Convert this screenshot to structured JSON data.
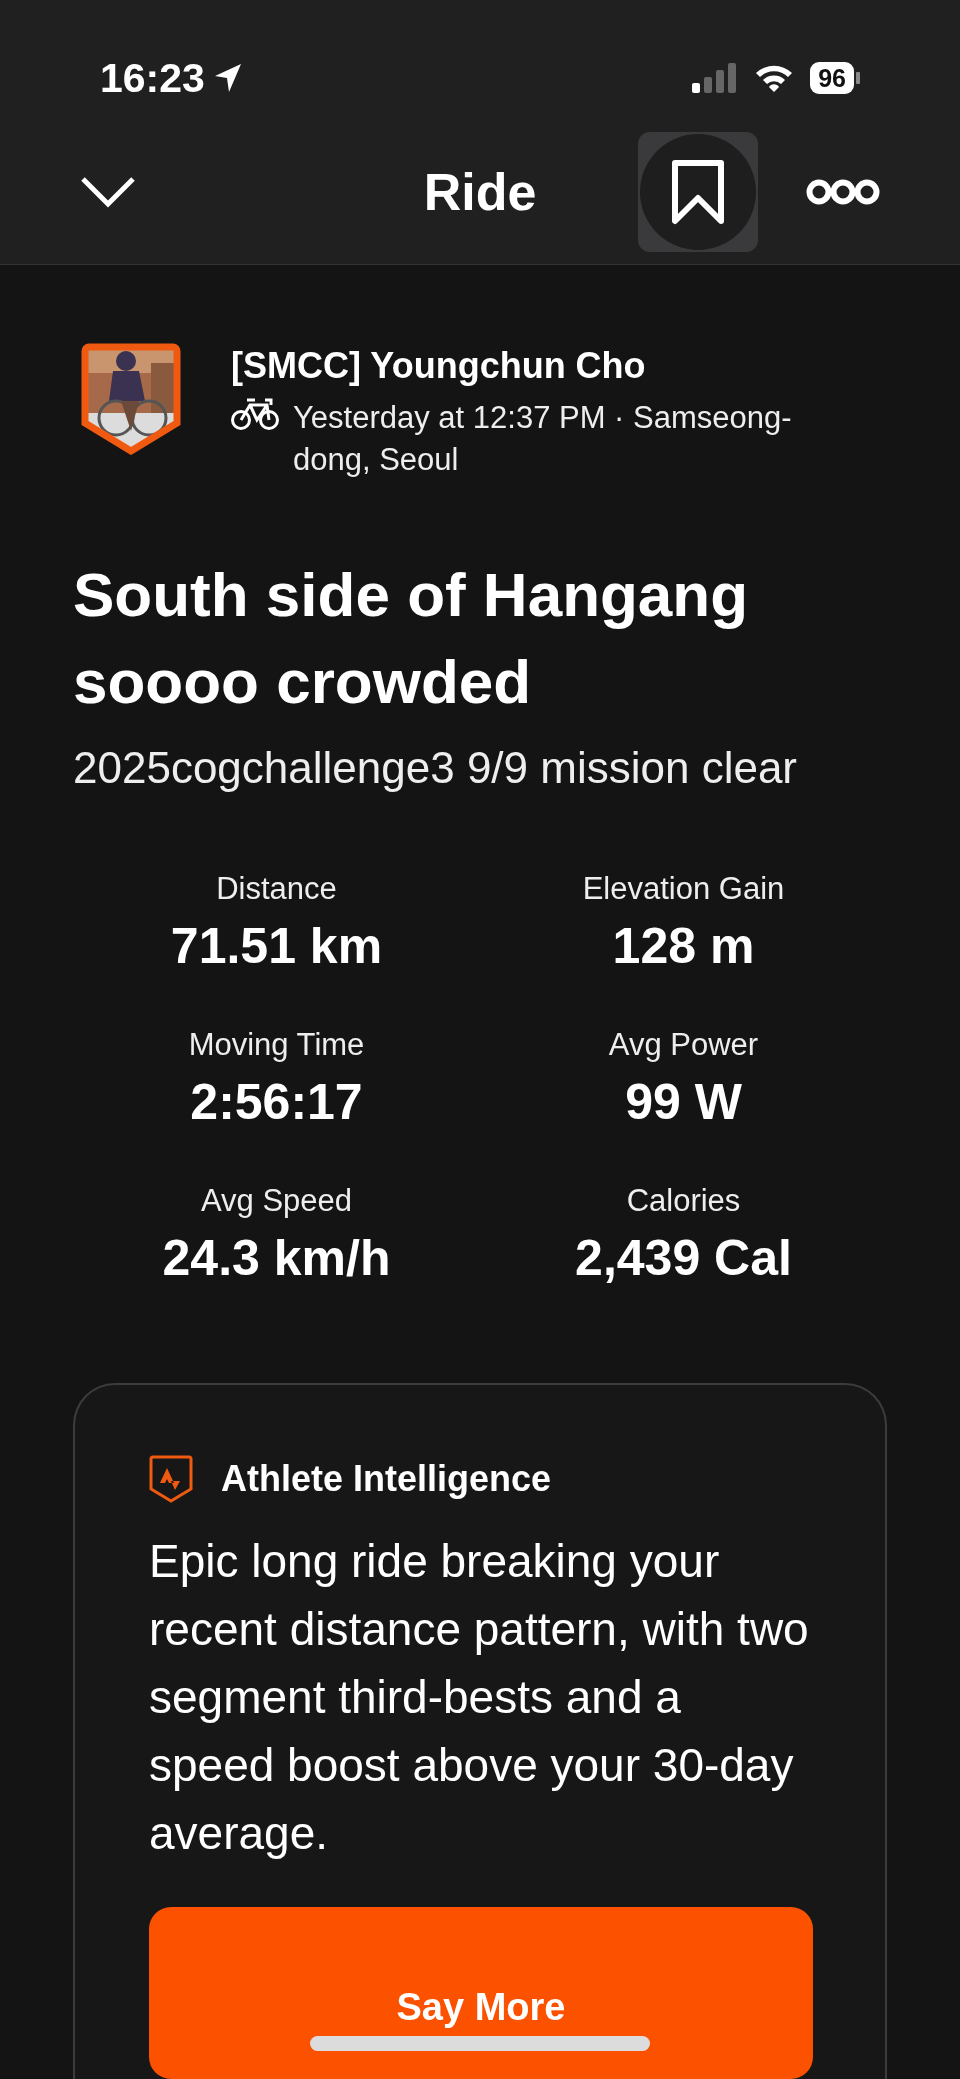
{
  "status_bar": {
    "time": "16:23",
    "battery": "96"
  },
  "nav": {
    "title": "Ride"
  },
  "athlete": {
    "name": "[SMCC] Youngchun Cho",
    "meta": "Yesterday at 12:37 PM · Samseong-dong, Seoul"
  },
  "activity": {
    "title": "South side of Hangang soooo crowded",
    "description": "2025cogchallenge3 9/9 mission clear"
  },
  "stats": [
    {
      "label": "Distance",
      "value": "71.51 km"
    },
    {
      "label": "Elevation Gain",
      "value": "128 m"
    },
    {
      "label": "Moving Time",
      "value": "2:56:17"
    },
    {
      "label": "Avg Power",
      "value": "99 W"
    },
    {
      "label": "Avg Speed",
      "value": "24.3 km/h"
    },
    {
      "label": "Calories",
      "value": "2,439 Cal"
    }
  ],
  "insight": {
    "title": "Athlete Intelligence",
    "text": "Epic long ride breaking your recent distance pattern, with two segment third-bests and a speed boost above your 30-day average.",
    "button": "Say More"
  }
}
